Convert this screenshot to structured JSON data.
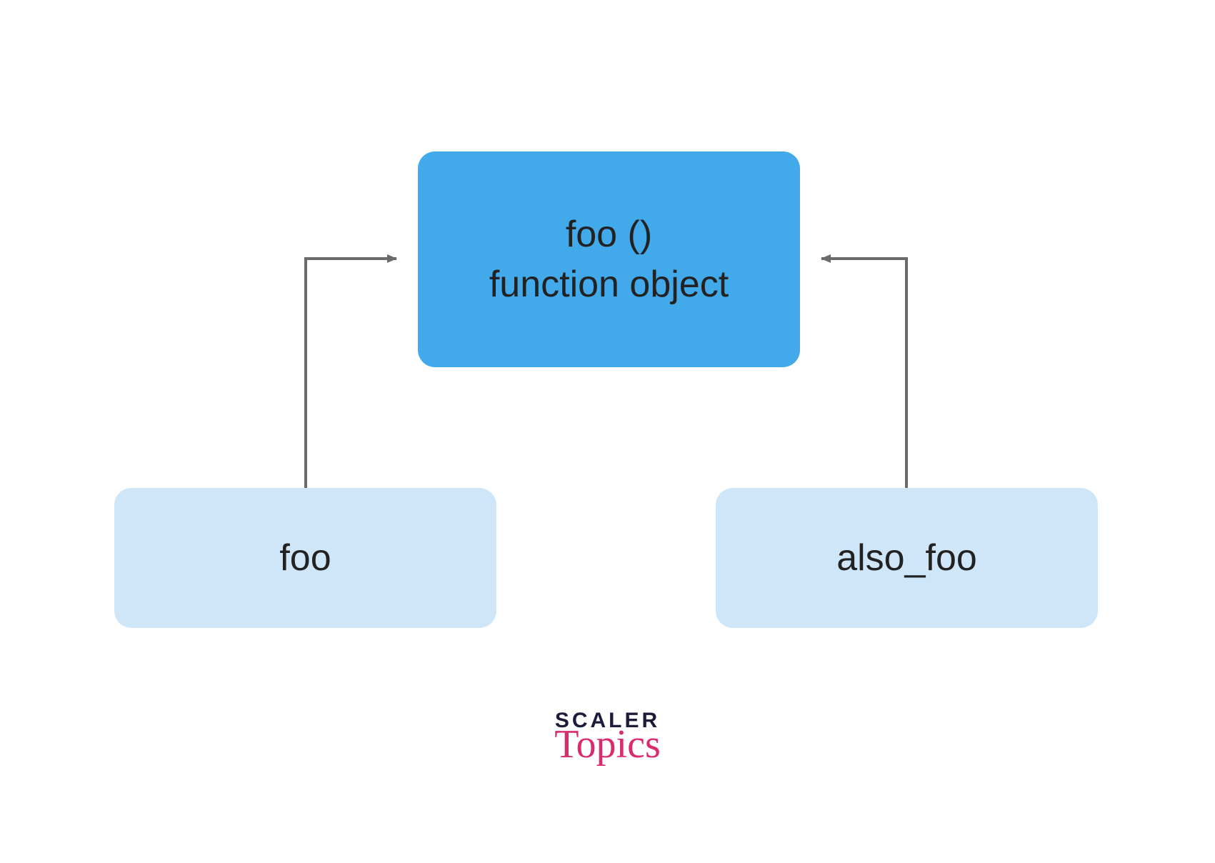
{
  "top_box": {
    "line1": "foo ()",
    "line2": "function object"
  },
  "left_box": {
    "label": "foo"
  },
  "right_box": {
    "label": "also_foo"
  },
  "logo": {
    "line1": "SCALER",
    "line2": "Topics"
  },
  "colors": {
    "top_box_bg": "#42a9eb",
    "bottom_box_bg": "#cfe6f9",
    "arrow": "#6b6b6b",
    "logo_primary": "#1b1b3a",
    "logo_accent": "#dc2a6e"
  }
}
